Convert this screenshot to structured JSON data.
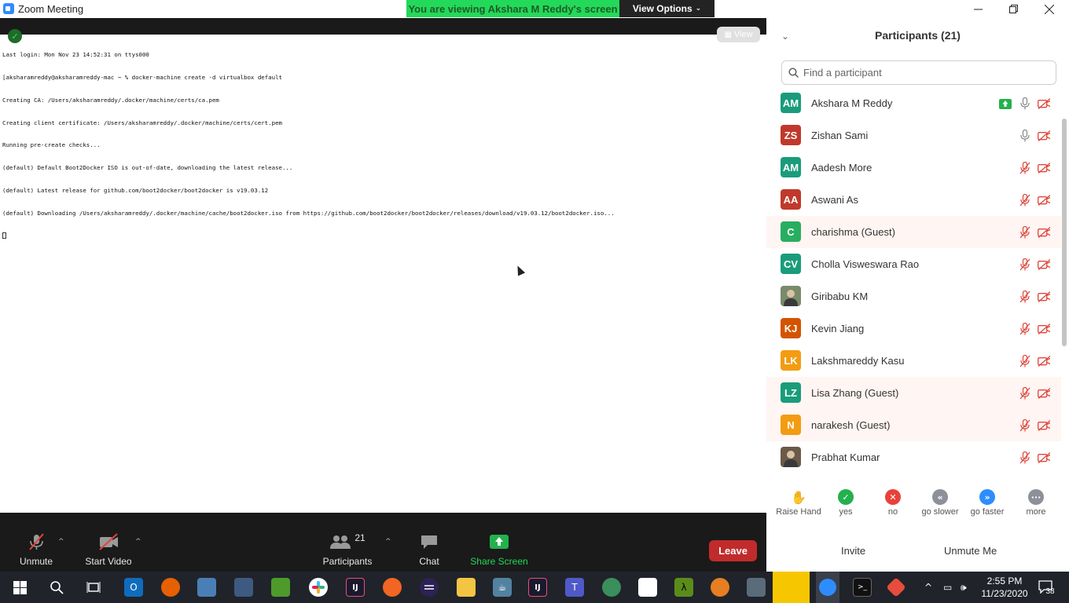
{
  "window": {
    "title": "Zoom Meeting"
  },
  "banner": {
    "viewing_text": "You are viewing Akshara M Reddy's screen",
    "view_options_label": "View Options"
  },
  "share": {
    "view_label": "View",
    "terminal_lines": [
      "Last login: Mon Nov 23 14:52:31 on ttys000",
      "[aksharamreddy@aksharamreddy-mac ~ % docker-machine create -d virtualbox default",
      "Creating CA: /Users/aksharamreddy/.docker/machine/certs/ca.pem",
      "Creating client certificate: /Users/aksharamreddy/.docker/machine/certs/cert.pem",
      "Running pre-create checks...",
      "(default) Default Boot2Docker ISO is out-of-date, downloading the latest release...",
      "(default) Latest release for github.com/boot2docker/boot2docker is v19.03.12",
      "(default) Downloading /Users/aksharamreddy/.docker/machine/cache/boot2docker.iso from https://github.com/boot2docker/boot2docker/releases/download/v19.03.12/boot2docker.iso..."
    ]
  },
  "toolbar": {
    "unmute_label": "Unmute",
    "start_video_label": "Start Video",
    "participants_label": "Participants",
    "participants_count": "21",
    "chat_label": "Chat",
    "share_screen_label": "Share Screen",
    "leave_label": "Leave"
  },
  "panel": {
    "title": "Participants (21)",
    "search_placeholder": "Find a participant",
    "participants": [
      {
        "initials": "AM",
        "name": "Akshara M Reddy",
        "color": "#1a9c7b",
        "mic": "on",
        "sharing": true,
        "highlight": false
      },
      {
        "initials": "ZS",
        "name": "Zishan Sami",
        "color": "#c0392b",
        "mic": "on",
        "sharing": false,
        "highlight": false
      },
      {
        "initials": "AM",
        "name": "Aadesh More",
        "color": "#1a9c7b",
        "mic": "muted",
        "sharing": false,
        "highlight": false
      },
      {
        "initials": "AA",
        "name": "Aswani As",
        "color": "#c0392b",
        "mic": "muted",
        "sharing": false,
        "highlight": false
      },
      {
        "initials": "C",
        "name": "charishma (Guest)",
        "color": "#27ae60",
        "mic": "muted",
        "sharing": false,
        "highlight": true
      },
      {
        "initials": "CV",
        "name": "Cholla Visweswara Rao",
        "color": "#1a9c7b",
        "mic": "muted",
        "sharing": false,
        "highlight": false
      },
      {
        "initials": "",
        "name": "Giribabu KM",
        "color": "#7a8a6a",
        "mic": "muted",
        "sharing": false,
        "highlight": false
      },
      {
        "initials": "KJ",
        "name": "Kevin Jiang",
        "color": "#d35400",
        "mic": "muted",
        "sharing": false,
        "highlight": false
      },
      {
        "initials": "LK",
        "name": "Lakshmareddy Kasu",
        "color": "#f39c12",
        "mic": "muted",
        "sharing": false,
        "highlight": false
      },
      {
        "initials": "LZ",
        "name": "Lisa Zhang (Guest)",
        "color": "#1a9c7b",
        "mic": "muted",
        "sharing": false,
        "highlight": true
      },
      {
        "initials": "N",
        "name": "narakesh (Guest)",
        "color": "#f39c12",
        "mic": "muted",
        "sharing": false,
        "highlight": true
      },
      {
        "initials": "",
        "name": "Prabhat Kumar",
        "color": "#6b5a4a",
        "mic": "muted",
        "sharing": false,
        "highlight": false
      }
    ],
    "reactions": [
      {
        "label": "Raise Hand",
        "color": "#2d8cff",
        "glyph": "✋"
      },
      {
        "label": "yes",
        "color": "#23b14d",
        "glyph": "✓"
      },
      {
        "label": "no",
        "color": "#e8413b",
        "glyph": "✕"
      },
      {
        "label": "go slower",
        "color": "#8e9099",
        "glyph": "«"
      },
      {
        "label": "go faster",
        "color": "#2d8cff",
        "glyph": "»"
      },
      {
        "label": "more",
        "color": "#8e9099",
        "glyph": "···"
      }
    ],
    "invite_label": "Invite",
    "unmute_me_label": "Unmute Me"
  },
  "taskbar": {
    "time": "2:55 PM",
    "date": "11/23/2020",
    "notifications": "38"
  }
}
